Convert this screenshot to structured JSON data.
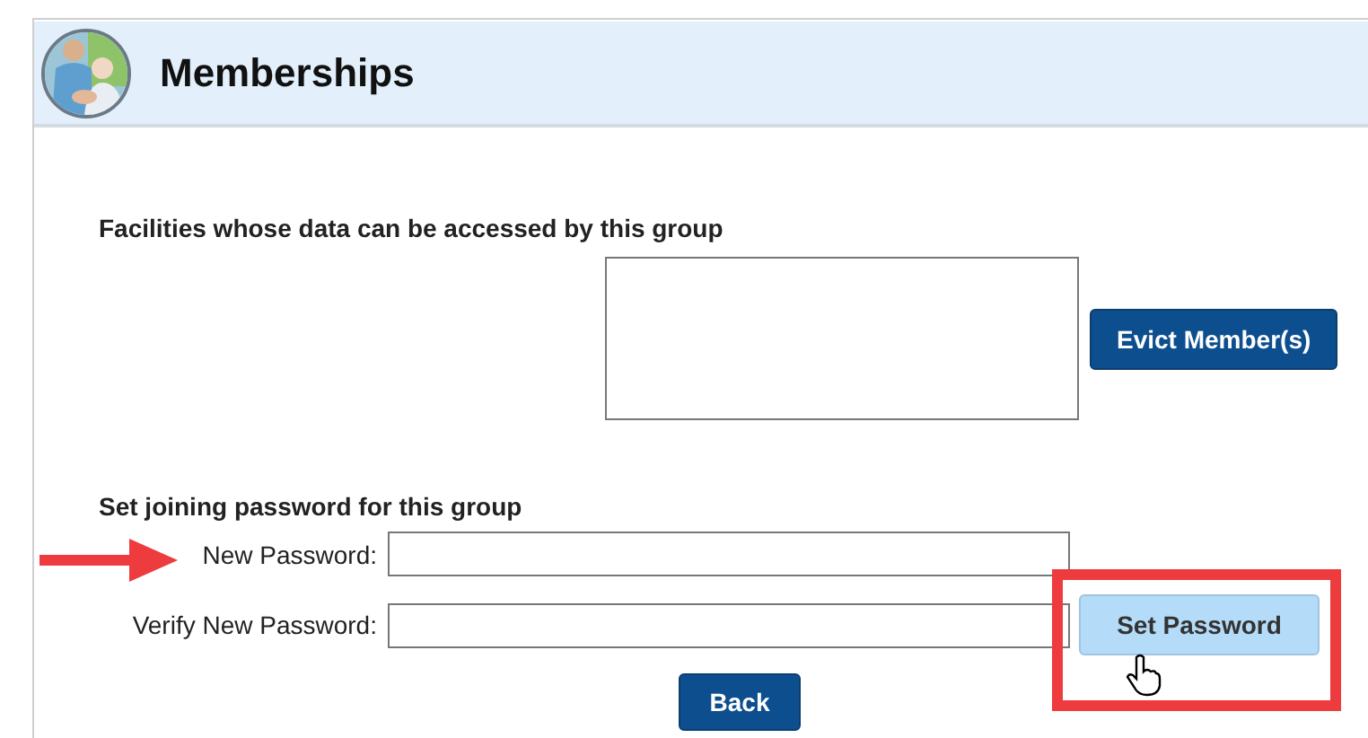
{
  "header": {
    "title": "Memberships"
  },
  "facilities": {
    "label": "Facilities whose data can be accessed by this group",
    "evict_button": "Evict Member(s)"
  },
  "password": {
    "heading": "Set joining password for this group",
    "fields": [
      {
        "label": "New Password:"
      },
      {
        "label": "Verify New Password:"
      }
    ],
    "set_button": "Set Password"
  },
  "back_button": "Back"
}
